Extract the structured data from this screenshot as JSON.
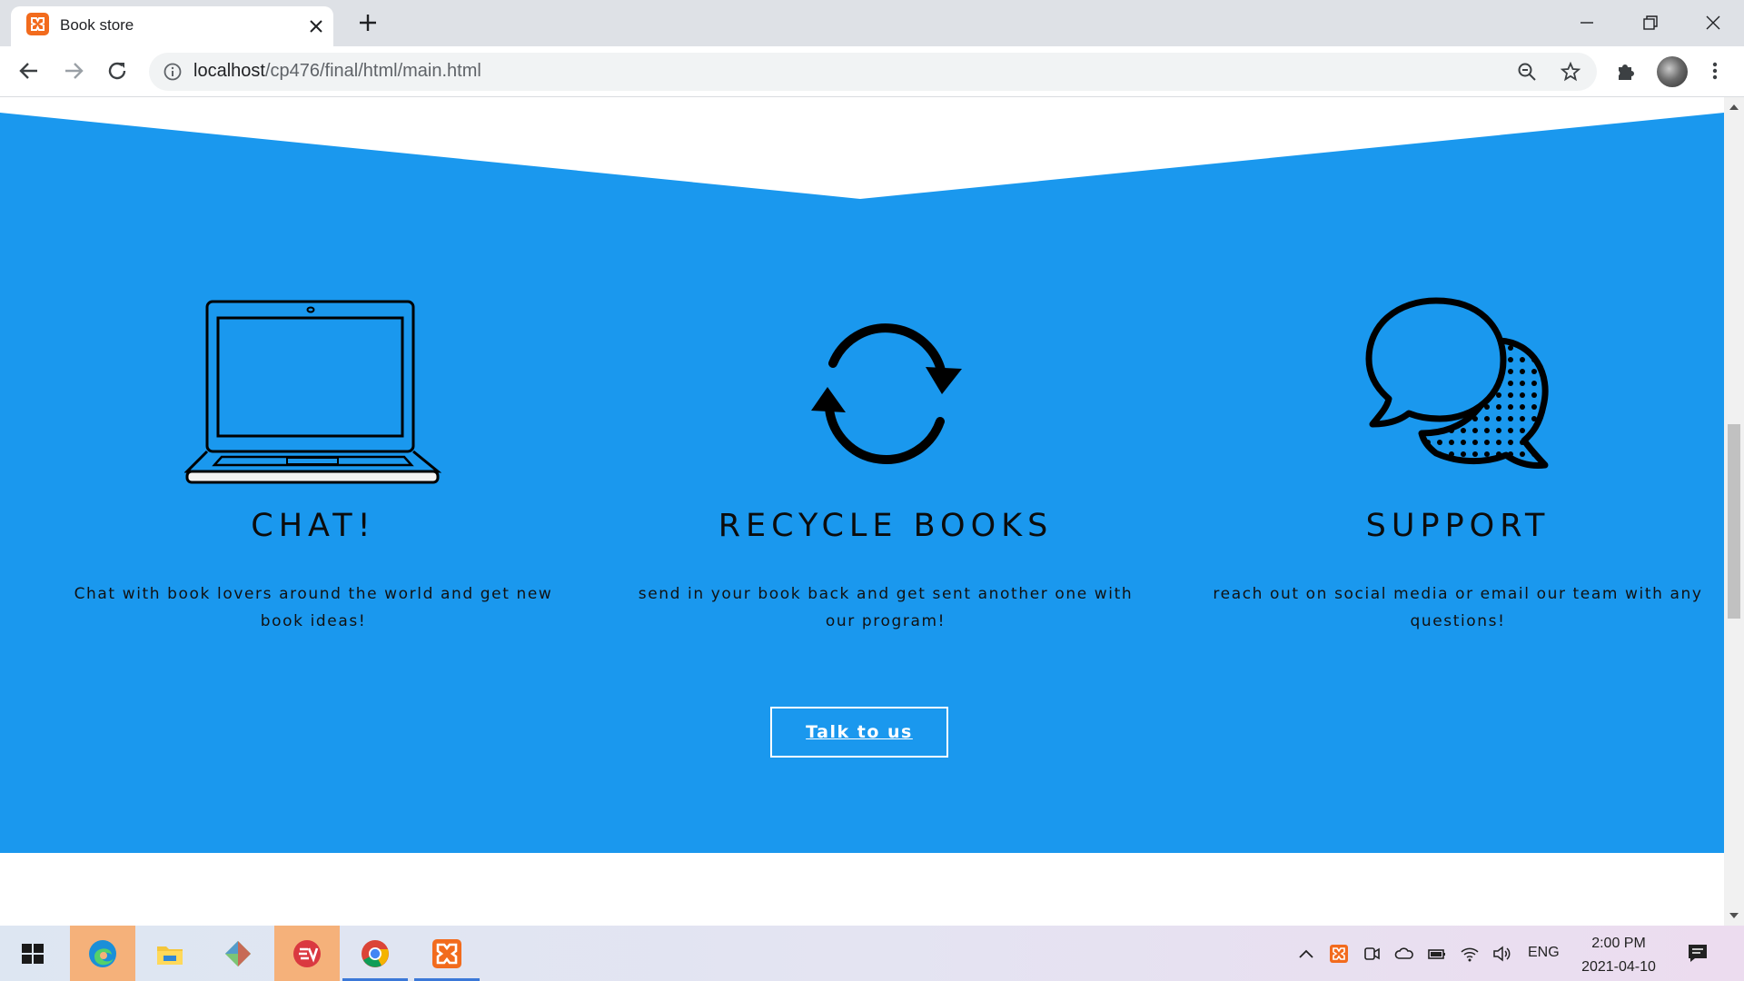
{
  "browser": {
    "tab_title": "Book store",
    "url_host": "localhost",
    "url_path": "/cp476/final/html/main.html"
  },
  "page": {
    "colors": {
      "section_bg": "#1a98ee",
      "button_border": "#ffffff"
    },
    "features": [
      {
        "icon": "laptop-icon",
        "heading": "CHAT!",
        "text": "Chat with book lovers around the world and get new book ideas!"
      },
      {
        "icon": "recycle-icon",
        "heading": "RECYCLE BOOKS",
        "text": "send in your book back and get sent another one with our program!"
      },
      {
        "icon": "speech-bubbles-icon",
        "heading": "SUPPORT",
        "text": "reach out on social media or email our team with any questions!"
      }
    ],
    "cta_label": "Talk to us"
  },
  "taskbar": {
    "apps": [
      "windows-start-icon",
      "edge-icon",
      "file-explorer-icon",
      "git-icon",
      "expressvpn-icon",
      "chrome-icon",
      "xampp-icon"
    ],
    "language": "ENG",
    "time": "2:00 PM",
    "date": "2021-04-10"
  }
}
